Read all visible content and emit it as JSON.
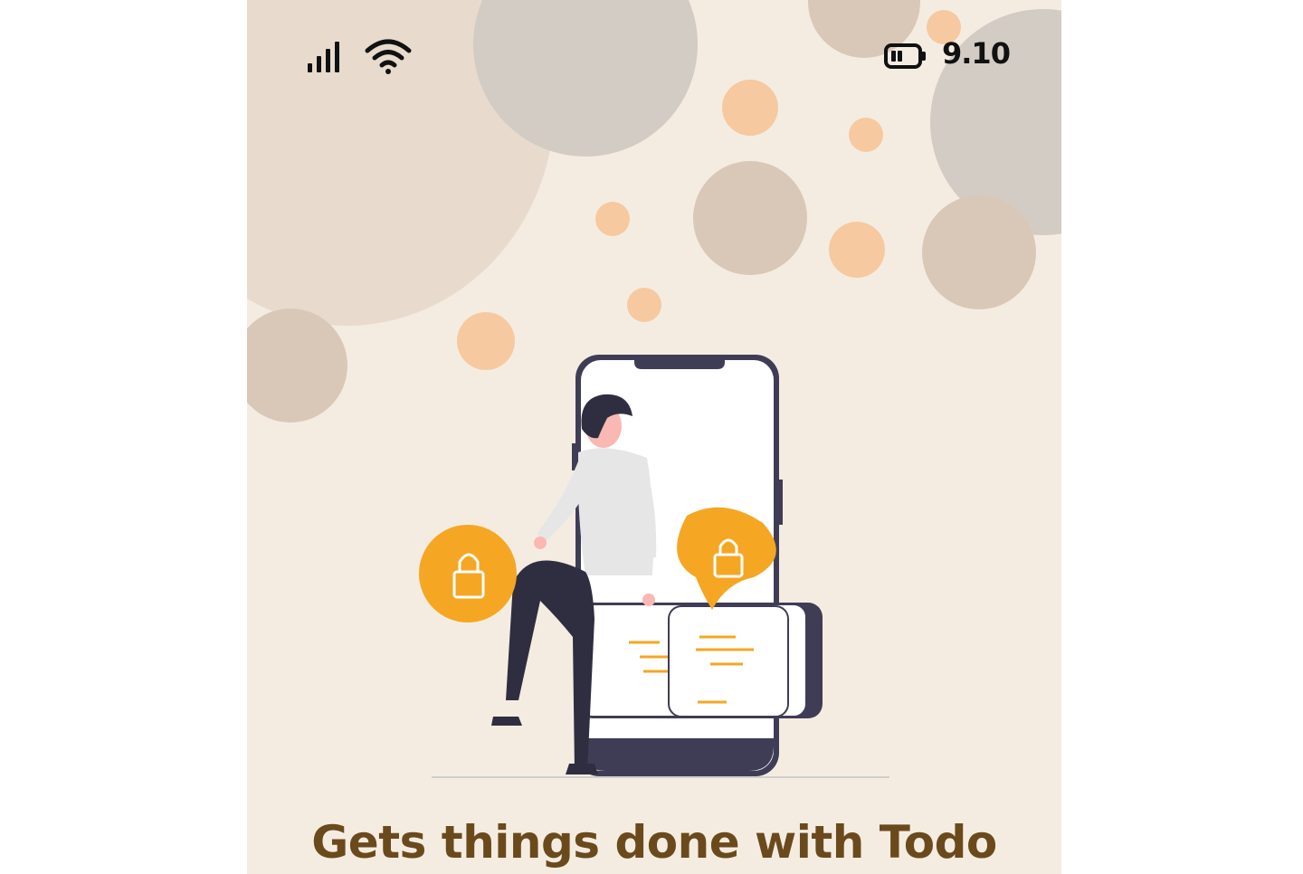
{
  "status_bar": {
    "time": "9.10",
    "signal_icon": "cellular-signal-icon",
    "wifi_icon": "wifi-icon",
    "battery_icon": "battery-low-icon"
  },
  "onboarding": {
    "headline": "Gets things done with Todo",
    "illustration": "person-with-phone-and-locks-illustration"
  },
  "colors": {
    "background": "#f5ece1",
    "accent_orange": "#f5a623",
    "headline": "#6a4a1c",
    "bubble_grey": "#d3ccc4",
    "bubble_tan": "#d9c8b8",
    "bubble_peach": "#f6c9a0"
  }
}
